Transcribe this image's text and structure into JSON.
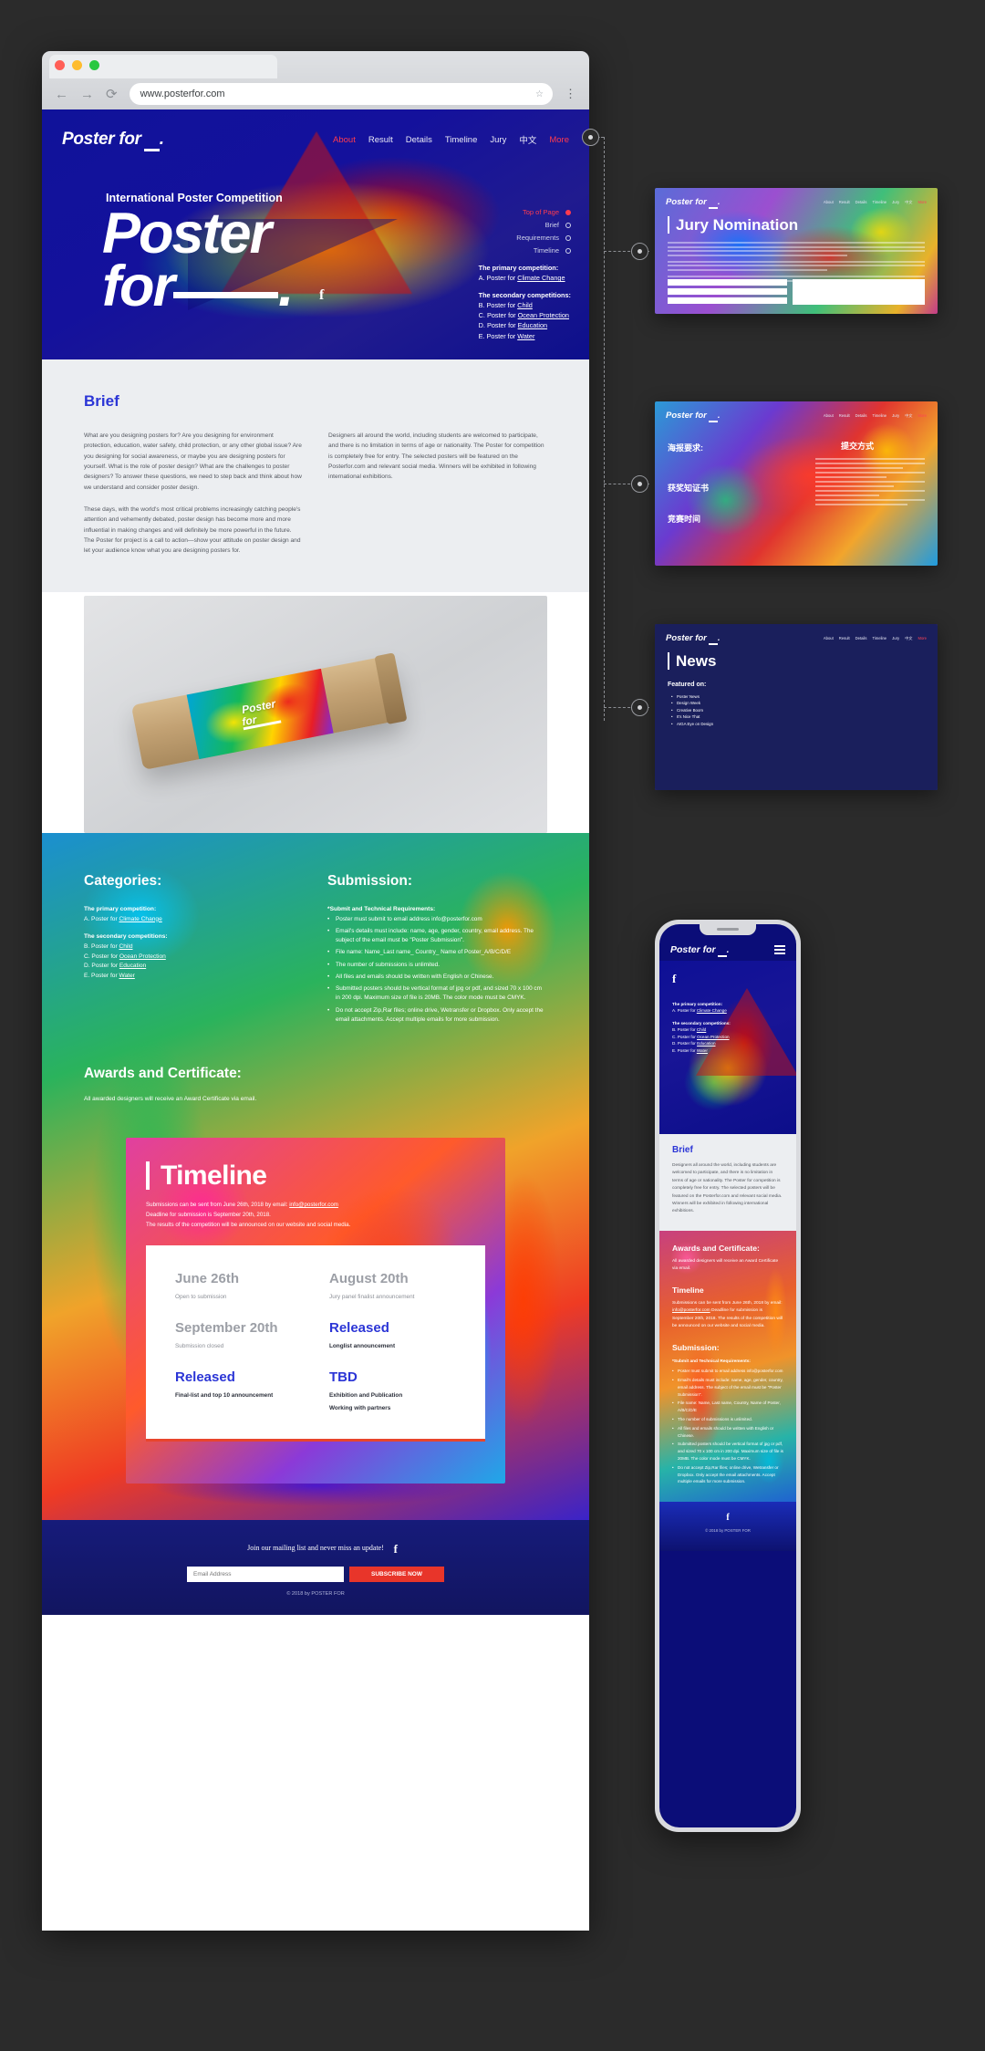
{
  "browser": {
    "url": "www.posterfor.com",
    "back_icon": "arrow-left-icon",
    "forward_icon": "arrow-right-icon",
    "reload_icon": "reload-icon",
    "star_icon": "star-icon",
    "menu_icon": "kebab-menu-icon"
  },
  "site": {
    "brand": "Poster for",
    "nav": [
      {
        "label": "About",
        "active": true
      },
      {
        "label": "Result",
        "active": false
      },
      {
        "label": "Details",
        "active": false
      },
      {
        "label": "Timeline",
        "active": false
      },
      {
        "label": "Jury",
        "active": false
      },
      {
        "label": "中文",
        "active": false
      },
      {
        "label": "More",
        "active": true
      }
    ]
  },
  "hero": {
    "eyebrow": "International Poster Competition",
    "title_line1": "Poster",
    "title_line2": "for",
    "title_period": ".",
    "facebook_icon": "facebook-icon",
    "anchors": [
      {
        "label": "Top of Page",
        "active": true
      },
      {
        "label": "Brief",
        "active": false
      },
      {
        "label": "Requirements",
        "active": false
      },
      {
        "label": "Timeline",
        "active": false
      }
    ],
    "primary_heading": "The primary competition:",
    "primary_items": [
      {
        "prefix": "A. Poster for ",
        "link": "Climate Change"
      }
    ],
    "secondary_heading": "The secondary competitions:",
    "secondary_items": [
      {
        "prefix": "B. Poster for ",
        "link": "Child"
      },
      {
        "prefix": "C. Poster for ",
        "link": "Ocean Protection"
      },
      {
        "prefix": "D. Poster for ",
        "link": "Education"
      },
      {
        "prefix": "E. Poster for ",
        "link": "Water"
      }
    ]
  },
  "brief": {
    "title": "Brief",
    "p1": "What are you designing posters for? Are you designing for environment protection, education, water safety, child protection, or any other global issue? Are you designing for social awareness, or maybe you are designing posters for yourself. What is the role of poster design? What are the challenges to poster designers? To answer these questions, we need to step back and think about how we understand and consider poster design.",
    "p2": "These days, with the world's most critical problems increasingly catching people's attention and vehemently debated, poster design has become more and more influential in making changes and will definitely be more powerful in the future. The Poster for project is a call to action—show your attitude on poster design and let your audience know what you are designing posters for.",
    "p3": "Designers all around the world, including students are welcomed to participate, and there is no limitation in terms of age or nationality. The Poster for competition is completely free for entry. The selected posters will be featured on the Posterfor.com and relevant social media. Winners will be exhibited in following international exhibitions."
  },
  "mockup": {
    "label_line1": "Poster",
    "label_line2": "for"
  },
  "categories": {
    "title": "Categories:",
    "primary_heading": "The primary competition:",
    "primary_items": [
      {
        "prefix": "A. Poster for ",
        "link": "Climate Change"
      }
    ],
    "secondary_heading": "The secondary competitions:",
    "secondary_items": [
      {
        "prefix": "B. Poster for ",
        "link": "Child"
      },
      {
        "prefix": "C. Poster for ",
        "link": "Ocean Protection"
      },
      {
        "prefix": "D. Poster for ",
        "link": "Education"
      },
      {
        "prefix": "E. Poster for ",
        "link": "Water"
      }
    ]
  },
  "submission": {
    "title": "Submission:",
    "subtitle": "*Submit and Technical Requirements:",
    "items": [
      "Poster must submit to email address info@posterfor.com",
      "Email's details must include: name, age, gender, country, email address. The subject of the email must be \"Poster Submission\".",
      "File name: Name_Last name_ Country_ Name of Poster_A/B/C/D/E",
      "The number of submissions is unlimited.",
      "All files and emails should be written with English or Chinese.",
      "Submitted posters should be vertical format of jpg or pdf, and sized 70 x 100 cm in 200 dpi. Maximum size of file is 20MB. The color mode must be CMYK.",
      "Do not accept Zip,Rar files; online drive, Wetransfer or Dropbox. Only accept the email attachments. Accept multiple emails for more submission."
    ]
  },
  "awards": {
    "title": "Awards and Certificate:",
    "text": "All awarded designers will receive an Award Certificate via email."
  },
  "timeline": {
    "title": "Timeline",
    "meta_line1_prefix": "Submissions can be sent from June 26th, 2018 by email: ",
    "meta_email": "info@posterfor.com",
    "meta_line2": "Deadline for submission is September 20th, 2018.",
    "meta_line3": "The results of the competition will be announced on our website and social media.",
    "entries": [
      {
        "date": "June 26th",
        "released": false,
        "desc": "Open to submission",
        "bold": false
      },
      {
        "date": "August 20th",
        "released": false,
        "desc": "Jury panel finalist announcement",
        "bold": false
      },
      {
        "date": "September 20th",
        "released": false,
        "desc": "Submission closed",
        "bold": false
      },
      {
        "date": "Released",
        "released": true,
        "desc": "Longlist announcement",
        "bold": true
      },
      {
        "date": "Released",
        "released": true,
        "desc": "Final-list and top 10 announcement",
        "bold": true
      },
      {
        "date": "TBD",
        "released": true,
        "desc": "Exhibition and Publication",
        "bold": true,
        "desc2": "Working with partners"
      }
    ]
  },
  "footer": {
    "join_text": "Join our mailing list and never miss an update!",
    "facebook_icon": "facebook-icon",
    "email_placeholder": "Email Address",
    "subscribe_label": "SUBSCRIBE NOW",
    "copyright": "© 2018 by POSTER FOR"
  },
  "thumbnails": {
    "jury": {
      "brand": "Poster for",
      "title": "Jury Nomination",
      "nav": [
        "About",
        "Result",
        "Details",
        "Timeline",
        "Jury",
        "中文",
        "More"
      ]
    },
    "chinese": {
      "brand": "Poster for",
      "nav": [
        "About",
        "Result",
        "Details",
        "Timeline",
        "Jury",
        "中文",
        "More"
      ],
      "h1": "海报要求:",
      "h2": "获奖知证书",
      "h3": "竞赛时间",
      "h4": "提交方式"
    },
    "news": {
      "brand": "Poster for",
      "nav": [
        "About",
        "Result",
        "Details",
        "Timeline",
        "Jury",
        "中文",
        "More"
      ],
      "title": "News",
      "featured_label": "Featured on:",
      "items": [
        "Poster News",
        "Design Week",
        "Creative Boom",
        "It's Nice That",
        "AIGA Eye on Design"
      ]
    }
  },
  "phone": {
    "brand": "Poster for",
    "menu_icon": "hamburger-menu-icon",
    "facebook_icon": "facebook-icon",
    "primary_heading": "The primary competition:",
    "primary_items": [
      {
        "prefix": "A. Poster for ",
        "link": "Climate Change"
      }
    ],
    "secondary_heading": "The secondary competitions:",
    "secondary_items": [
      {
        "prefix": "B. Poster for ",
        "link": "Child"
      },
      {
        "prefix": "C. Poster for ",
        "link": "Ocean Protection"
      },
      {
        "prefix": "D. Poster for ",
        "link": "Education"
      },
      {
        "prefix": "E. Poster for ",
        "link": "Water"
      }
    ],
    "brief_title": "Brief",
    "brief_text": "Designers all around the world, including students are welcomed to participate, and there is no limitation in terms of age or nationality. The Poster for competition is completely free for entry. The selected posters will be featured on the Posterfor.com and relevant social media. Winners will be exhibited in following international exhibitions.",
    "awards_title": "Awards and Certificate:",
    "awards_text": "All awarded designers will receive an Award Certificate via email.",
    "timeline_title": "Timeline",
    "timeline_text_1": "Submissions can be sent from June 26th, 2018 by email: ",
    "timeline_email": "info@posterfor.com",
    "timeline_text_2": "Deadline for submission is September 20th, 2018.",
    "timeline_text_3": "The results of the competition will be announced on our website and social media.",
    "submission_title": "Submission:",
    "submission_subtitle": "*Submit and Technical Requirements:",
    "submission_items": [
      "Poster must submit to email address info@posterfor.com",
      "Email's details must include: name, age, gender, country, email address. The subject of the email must be \"Poster Submission\".",
      "File name: Name, Last name, Country, Name of Poster, A/B/C/D/E",
      "The number of submissions is unlimited.",
      "All files and emails should be written with English or Chinese.",
      "Submitted posters should be vertical format of jpg or pdf, and sized 70 x 100 cm in 200 dpi. Maximum size of file is 20MB. The color mode must be CMYK.",
      "Do not accept Zip,Rar files; online drive, Wetransfer or Dropbox. Only accept the email attachments. Accept multiple emails for more submission."
    ],
    "footer_copyright": "© 2018 by POSTER FOR"
  }
}
